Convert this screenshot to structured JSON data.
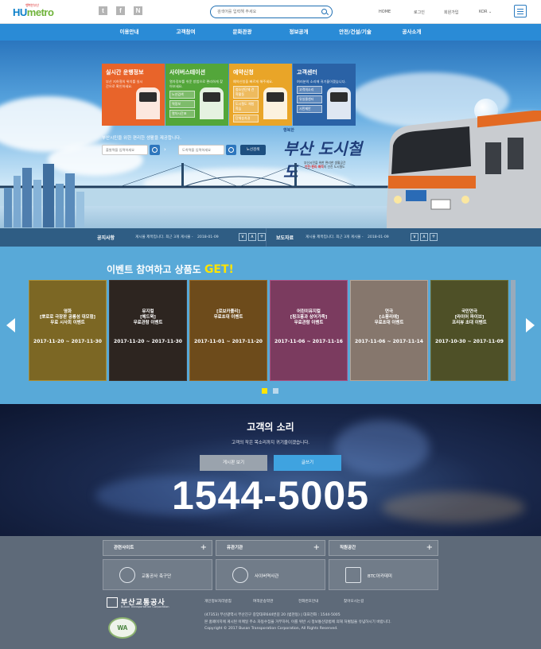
{
  "header": {
    "logo_main": "HU",
    "logo_sub": "metro",
    "logo_small": "행복한 부산",
    "sns": [
      "t-icon",
      "f-icon",
      "n-icon"
    ],
    "sns_glyphs": [
      "t",
      "f",
      "N"
    ],
    "search_placeholder": "검색어를 입력해 주세요",
    "links": [
      "HOME",
      "로그인",
      "회원가입",
      "KOR"
    ]
  },
  "nav": [
    "이용안내",
    "고객참여",
    "문화관광",
    "정보공개",
    "안전/건설/기술",
    "공사소개"
  ],
  "hero": {
    "tiles": [
      {
        "title": "실시간 운행정보",
        "desc": "부산 지하철의 위치를 실시간으로 확인하세요.",
        "buttons": [],
        "color": "#e8642a"
      },
      {
        "title": "사이버스테이션",
        "desc": "열차정보를 쉬운 방법으로 편리하게 찾아보세요.",
        "buttons": [
          "노선검색",
          "역정보",
          "열차시간표"
        ],
        "color": "#53a63a"
      },
      {
        "title": "예약신청",
        "desc": "예약신청을 빠르게 해주세요.",
        "buttons": [
          "청소년단체 견학활동",
          "도시철도 체험학습",
          "단체승차권"
        ],
        "color": "#e9a528"
      },
      {
        "title": "고객센터",
        "desc": "여러분의 소리에 귀기울이겠습니다.",
        "buttons": [
          "고객의소리",
          "유실물센터",
          "시민제안"
        ],
        "color": "#2a62a6"
      }
    ],
    "tagline": "부산시민을 위한 편리한 생활을 제공합니다.",
    "start_placeholder": "출발역을 입력하세요",
    "end_placeholder": "도착역을 입력하세요",
    "route_button": "노선검색",
    "slogan_top": "행복한",
    "slogan_main": "부산 도시철도",
    "slogan_desc1": "부산시민을 위한 편리한 생활공간",
    "slogan_desc2_a": "안전·편리·쾌적",
    "slogan_desc2_b": "의 선진 도시철도"
  },
  "notices": [
    {
      "title": "공지사항",
      "text": "게시물 제목입니다. 최근 3개 게시물 - ",
      "date": "2018-01-09"
    },
    {
      "title": "보도자료",
      "text": "게시물 제목입니다. 최근 3개 게시물 - ",
      "date": "2018-01-09"
    }
  ],
  "notice_controls": [
    "∨",
    "∧",
    "+"
  ],
  "events": {
    "title_a": "이벤트 참여하고 상품도 ",
    "title_b": "GET!",
    "items": [
      {
        "title": "영화\n[뽀로로 극장판 공룡섬 대모험]\n무료 시사회 이벤트",
        "date": "2017-11-20 ~ 2017-11-30",
        "bg": "#c9a73b"
      },
      {
        "title": "뮤지컬\n[헤드윅]\n무료관람 이벤트",
        "date": "2017-11-20 ~ 2017-11-30",
        "bg": "#4a3d34"
      },
      {
        "title": "[로보카폴리]\n무료초대 이벤트",
        "date": "2017-11-01 ~ 2017-11-20",
        "bg": "#b0792c"
      },
      {
        "title": "어린이뮤지컬\n[핑크퐁과 상어가족]\n무료관람 이벤트",
        "date": "2017-11-06 ~ 2017-11-16",
        "bg": "#c7609a"
      },
      {
        "title": "연극\n[소풍리에]\n무료초대 이벤트",
        "date": "2017-11-06 ~ 2017-11-14",
        "bg": "#d8c1b0"
      },
      {
        "title": "국민연극\n[라이어 파이브]\n프리뷰 초대 이벤트",
        "date": "2017-10-30 ~ 2017-11-09",
        "bg": "#7e8240"
      }
    ]
  },
  "voice": {
    "title": "고객의 소리",
    "subtitle": "고객의 작은 목소리까지 귀기울이겠습니다.",
    "btn_view": "게시판 보기",
    "btn_write": "글쓰기",
    "phone": "1544-5005"
  },
  "footer": {
    "dropdowns": [
      "관련사이트",
      "유관기관",
      "직원공간"
    ],
    "cards": [
      {
        "label": "교통공사 축구단",
        "icon": "soccer-ball-icon"
      },
      {
        "label": "사이버역사관",
        "icon": "globe-icon"
      },
      {
        "label": "BTC아카데미",
        "icon": "building-icon"
      }
    ],
    "logo_ko": "부산교통공사",
    "logo_en": "Busan Transportation Corporation",
    "wa_mark": "WA",
    "links": [
      "개인정보처리방침",
      "여객운송약관",
      "전화번호안내",
      "찾아오시는길"
    ],
    "address": "(47353) 부산광역시 부산진구 중앙대로644번길 20 (범천동) | 대표전화 : 1544-5005",
    "notice_line": "본 홈페이지에 게시된 이메일 주소 자동수집을 거부하며, 이를 위반 시 정보통신망법에 의해 처벌됨을 유념하시기 바랍니다.",
    "copyright": "Copyright © 2017 Busan Transporation Corporation, All Rights Reserved."
  }
}
